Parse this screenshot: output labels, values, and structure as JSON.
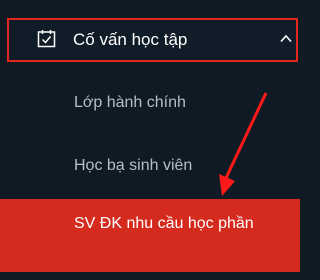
{
  "menu": {
    "header": {
      "label": "Cố vấn học tập",
      "icon": "calendar-check-icon",
      "expanded_icon": "chevron-up-icon"
    },
    "items": [
      {
        "label": "Lớp hành chính"
      },
      {
        "label": "Học bạ sinh viên"
      }
    ],
    "active_item": {
      "label": "SV ĐK nhu cầu học phần"
    }
  },
  "colors": {
    "background": "#0f1a24",
    "accent_red": "#d52b1e",
    "highlight_border": "#e0281e",
    "header_text": "#ffffff",
    "item_text": "#b7bec5"
  }
}
